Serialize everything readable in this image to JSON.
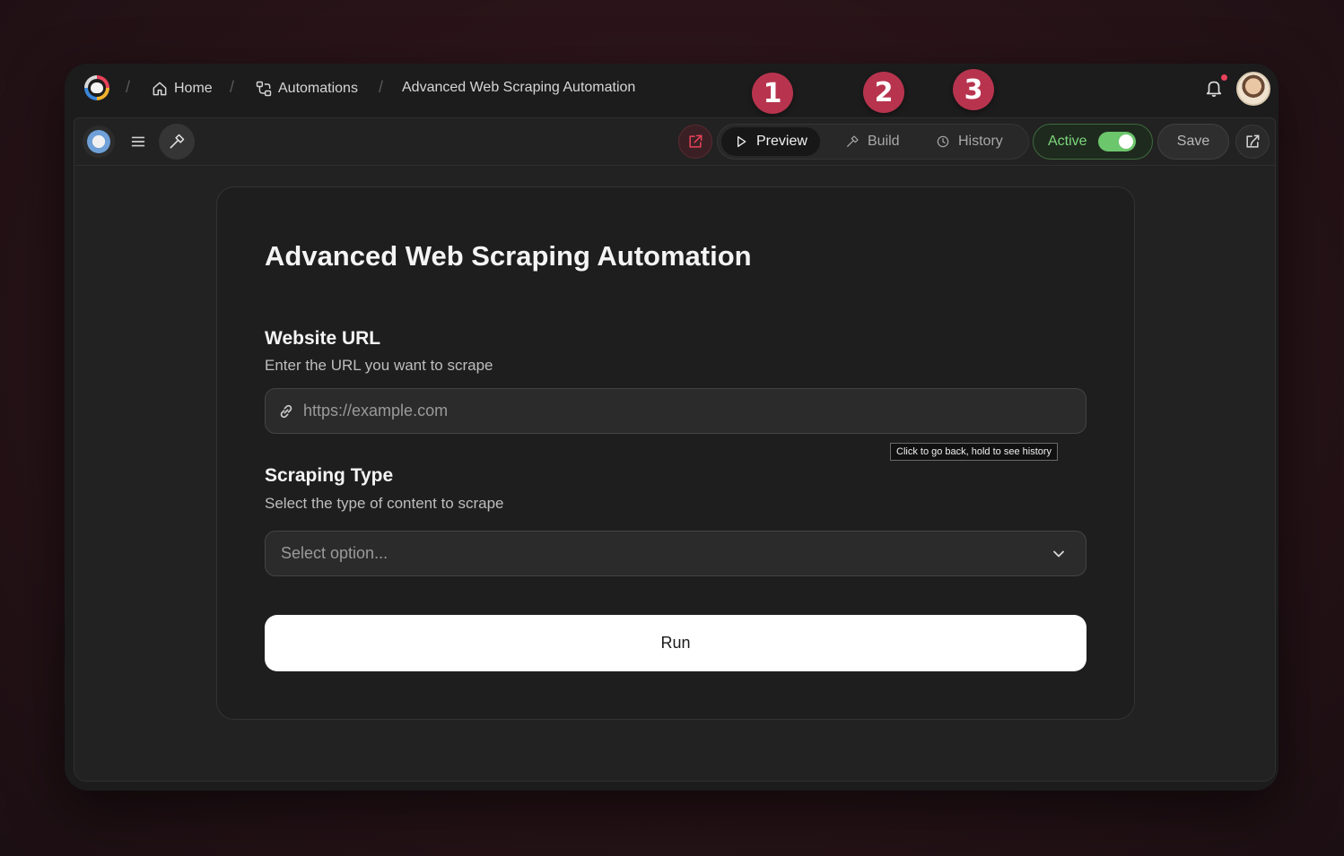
{
  "breadcrumbs": {
    "home": "Home",
    "automations": "Automations",
    "current": "Advanced Web Scraping Automation",
    "separator": "/"
  },
  "toolbar": {
    "tabs": [
      {
        "label": "Preview",
        "icon": "play-icon",
        "active": true
      },
      {
        "label": "Build",
        "icon": "hammer-icon",
        "active": false
      },
      {
        "label": "History",
        "icon": "clock-icon",
        "active": false
      }
    ],
    "status_label": "Active",
    "status_on": true,
    "save_label": "Save"
  },
  "annotations": [
    "1",
    "2",
    "3"
  ],
  "form": {
    "title": "Advanced Web Scraping Automation",
    "url_label": "Website URL",
    "url_help": "Enter the URL you want to scrape",
    "url_placeholder": "https://example.com",
    "type_label": "Scraping Type",
    "type_help": "Select the type of content to scrape",
    "type_placeholder": "Select option...",
    "run_label": "Run"
  },
  "tooltip": "Click to go back, hold to see history",
  "colors": {
    "accent_red": "#b8344e",
    "active_green": "#6cc66c",
    "notification_dot": "#e8425a"
  }
}
